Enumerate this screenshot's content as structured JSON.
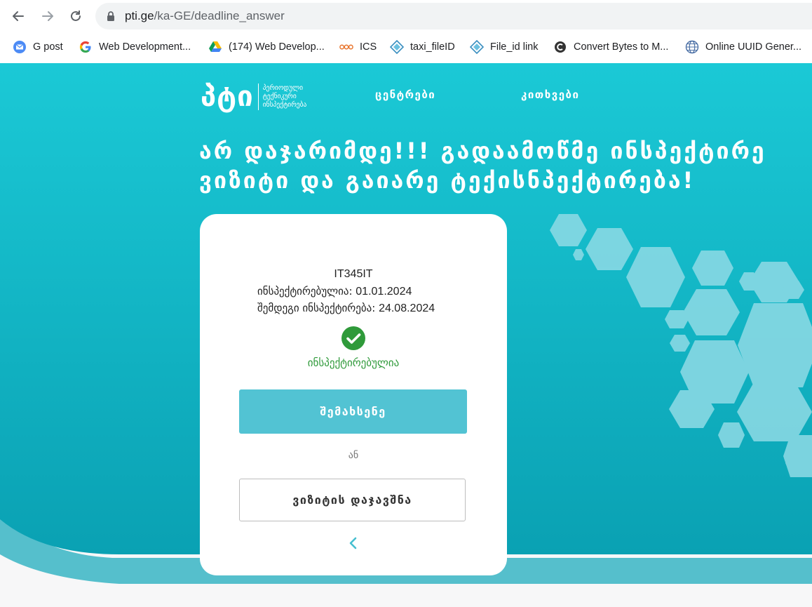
{
  "browser": {
    "url_host": "pti.ge",
    "url_path": "/ka-GE/deadline_answer",
    "bookmarks": [
      {
        "label": "G post",
        "icon": "mail-icon"
      },
      {
        "label": "Web Development...",
        "icon": "google-icon"
      },
      {
        "label": "(174) Web Develop...",
        "icon": "google-drive-icon"
      },
      {
        "label": "ICS",
        "icon": "ics-icon"
      },
      {
        "label": "taxi_fileID",
        "icon": "diamond-icon"
      },
      {
        "label": "File_id link",
        "icon": "diamond-icon"
      },
      {
        "label": "Convert Bytes to M...",
        "icon": "convert-icon"
      },
      {
        "label": "Online UUID Gener...",
        "icon": "globe-icon"
      }
    ]
  },
  "site": {
    "logo_mark": "პტი",
    "logo_lines": [
      "პერიოდული",
      "ტექნიკური",
      "ინსპექტირება"
    ],
    "menu": [
      "ცენტრები",
      "კითხვები"
    ],
    "headline_line1": "არ დაჯარიმდე!!! გადაამოწმე ინსპექტირე",
    "headline_line2": "ვიზიტი და გაიარე ტექისნპექტირება!"
  },
  "card": {
    "plate": "IT345IT",
    "inspected_label": "ინსპექტირებულია:",
    "inspected_date": "01.01.2024",
    "next_label": "შემდეგი ინსპექტირება:",
    "next_date": "24.08.2024",
    "status_text": "ინსპექტირებულია",
    "remind_button": "შემახსენე",
    "or_text": "ან",
    "book_button": "ვიზიტის დაჯავშნა"
  },
  "colors": {
    "teal_light": "#1bc9d6",
    "teal_dark": "#0aa1b3",
    "accent_button": "#52c3d3",
    "success_green": "#2f9a3a"
  }
}
